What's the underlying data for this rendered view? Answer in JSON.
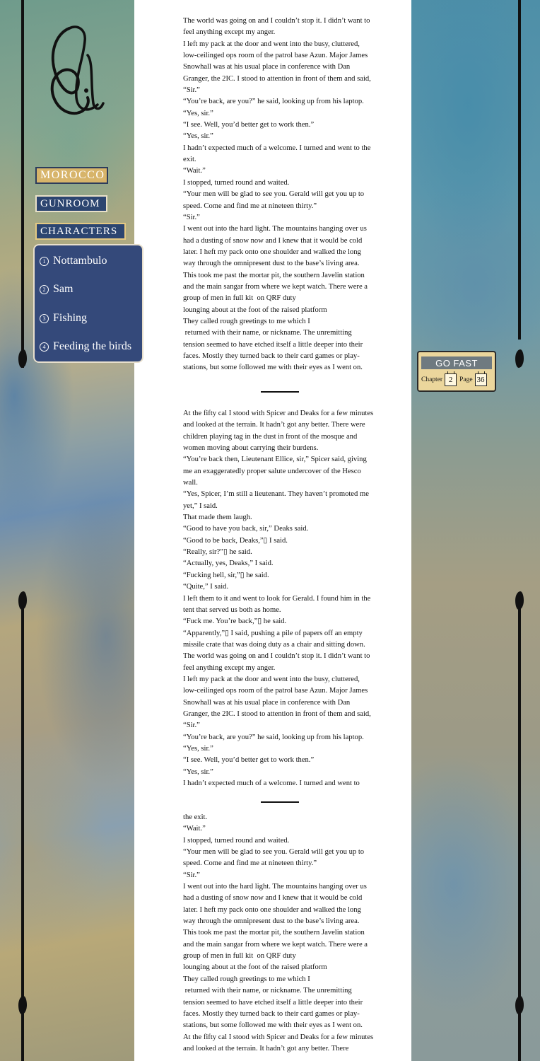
{
  "nav": {
    "morocco": "MOROCCO",
    "gunroom": "GUNROOM",
    "characters": "CHARACTERS"
  },
  "characters": [
    {
      "num": "1",
      "label": "Nottambulo"
    },
    {
      "num": "2",
      "label": "Sam"
    },
    {
      "num": "3",
      "label": "Fishing"
    },
    {
      "num": "4",
      "label": "Feeding the birds"
    }
  ],
  "go_fast": {
    "button": "GO FAST",
    "chapter_label": "Chapter",
    "chapter_value": "2",
    "page_label": "Page",
    "page_value": "36"
  },
  "article": {
    "block1": [
      "The world was going on and I couldn’t stop it. I didn’t want to feel anything except my anger.",
      "I left my pack at the door and went into the busy, cluttered, low-ceilinged ops room of the patrol base Azun. Major James Snowhall was at his usual place in conference with Dan Granger, the 2IC. I stood to attention in front of them and said, “Sir.”",
      "“You’re back, are you?” he said, looking up from his laptop.",
      "“Yes, sir.”",
      "“I see. Well, you’d better get to work then.”",
      "“Yes, sir.”",
      "I hadn’t expected much of a welcome. I turned and went to the exit.",
      "“Wait.”",
      "I stopped, turned round and waited.",
      "“Your men will be glad to see you. Gerald will get you up to speed. Come and find me at nineteen thirty.”",
      "“Sir.”",
      "I went out into the hard light. The mountains hanging over us had a dusting of snow now and I knew that it would be cold later. I heft my pack onto one shoulder and walked the long way through the omnipresent dust to the base’s living area. This took me past the mortar pit, the southern Javelin station and the main sangar from where we kept watch. There were a group of men in full kit  on QRF duty",
      "lounging about at the foot of the raised platform",
      "They called rough greetings to me which I",
      " returned with their name, or nickname. The unremitting tension seemed to have etched itself a little deeper into their faces. Mostly they turned back to their card games or play-stations, but some followed me with their eyes as I went on."
    ],
    "block2": [
      "At the fifty cal I stood with Spicer and Deaks for a few minutes and looked at the terrain. It hadn’t got any better. There were children playing tag in the dust in front of the mosque and women moving about carrying their burdens.",
      "“You’re back then, Lieutenant Ellice, sir,” Spicer said, giving me an exaggeratedly proper salute undercover of the Hesco wall.",
      "“Yes, Spicer, I’m still a lieutenant. They haven’t promoted me yet,” I said.",
      "That made them laugh.",
      "“Good to have you back, sir,” Deaks said.",
      "“Good to be back, Deaks,”▯ I said.",
      "“Really, sir?”▯ he said.",
      "“Actually, yes, Deaks,” I said.",
      "“Fucking hell, sir,”▯ he said.",
      "“Quite,” I said.",
      "I left them to it and went to look for Gerald. I found him in the tent that served us both as home.",
      "“Fuck me. You’re back,”▯ he said.",
      "“Apparently,”▯ I said, pushing a pile of papers off an empty missile crate that was doing duty as a chair and sitting down.",
      "The world was going on and I couldn’t stop it. I didn’t want to feel anything except my anger.",
      "I left my pack at the door and went into the busy, cluttered, low-ceilinged ops room of the patrol base Azun. Major James Snowhall was at his usual place in conference with Dan Granger, the 2IC. I stood to attention in front of them and said, “Sir.”",
      "“You’re back, are you?” he said, looking up from his laptop.",
      "“Yes, sir.”",
      "“I see. Well, you’d better get to work then.”",
      "“Yes, sir.”",
      "I hadn’t expected much of a welcome. I turned and went to"
    ],
    "block3": [
      "the exit.",
      "“Wait.”",
      "I stopped, turned round and waited.",
      "“Your men will be glad to see you. Gerald will get you up to speed. Come and find me at nineteen thirty.”",
      "“Sir.”",
      "I went out into the hard light. The mountains hanging over us had a dusting of snow now and I knew that it would be cold later. I heft my pack onto one shoulder and walked the long way through the omnipresent dust to the base’s living area. This took me past the mortar pit, the southern Javelin station and the main sangar from where we kept watch. There were a group of men in full kit  on QRF duty",
      "lounging about at the foot of the raised platform",
      "They called rough greetings to me which I",
      " returned with their name, or nickname. The unremitting tension seemed to have etched itself a little deeper into their faces. Mostly they turned back to their card games or play-stations, but some followed me with their eyes as I went on.",
      "At the fifty cal I stood with Spicer and Deaks for a few minutes and looked at the terrain. It hadn’t got any better. There"
    ]
  }
}
